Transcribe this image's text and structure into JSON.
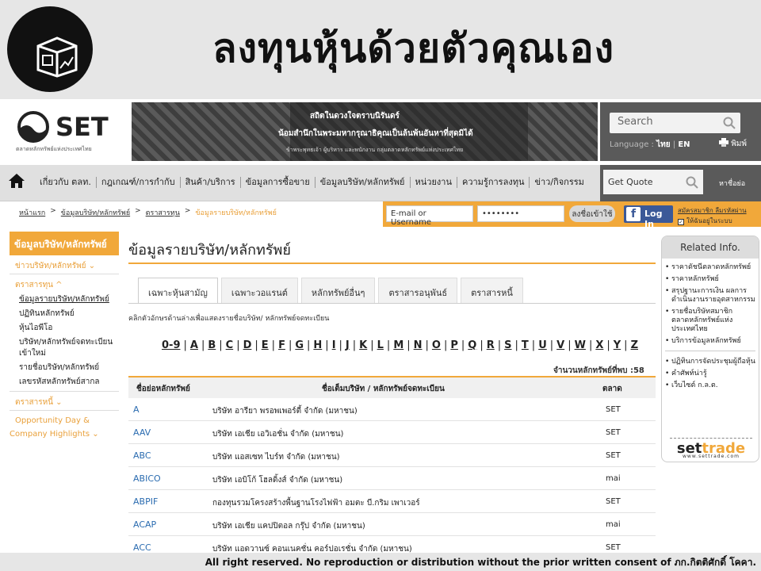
{
  "slide": {
    "title": "ลงทุนหุ้นด้วยตัวคุณเอง"
  },
  "header": {
    "logo_text": "SET",
    "logo_sub": "ตลาดหลักทรัพย์แห่งประเทศไทย",
    "banner_line1": "สถิตในดวงใจตราบนิรันดร์",
    "banner_line2": "น้อมสำนึกในพระมหากรุณาธิคุณเป็นล้นพ้นอันหาที่สุดมิได้",
    "banner_line3": "ข้าพระพุทธเจ้า ผู้บริหาร และพนักงาน กลุ่มตลาดหลักทรัพย์แห่งประเทศไทย",
    "search_placeholder": "Search",
    "language_label": "Language :",
    "lang_th": "ไทย",
    "lang_en": "EN",
    "print_label": "พิมพ์"
  },
  "nav": {
    "items": [
      "เกี่ยวกับ ตลท.",
      "กฎเกณฑ์/การกำกับ",
      "สินค้า/บริการ",
      "ข้อมูลการซื้อขาย",
      "ข้อมูลบริษัท/หลักทรัพย์",
      "หน่วยงาน",
      "ความรู้การลงทุน",
      "ข่าว/กิจกรรม"
    ],
    "quote_placeholder": "Get Quote",
    "find_label": "หาชื่อย่อ"
  },
  "breadcrumb": {
    "items": [
      "หน้าแรก",
      "ข้อมูลบริษัท/หลักทรัพย์",
      "ตราสารทุน"
    ],
    "current": "ข้อมูลรายบริษัท/หลักทรัพย์",
    "sep": ">"
  },
  "login": {
    "email_placeholder": "E-mail or Username",
    "password_value": "••••••••",
    "login_button": "ลงชื่อเข้าใช้",
    "fb_label": "Log In",
    "register": "สมัครสมาชิก",
    "forgot": "ลืมรหัสผ่าน",
    "remember": "ให้ฉันอยู่ในระบบ"
  },
  "sidebar": {
    "header": "ข้อมูลบริษัท/หลักทรัพย์",
    "section_news": "ข่าวบริษัท/หลักทรัพย์ ⌄",
    "section_equity": "ตราสารทุน ^",
    "items": [
      "ข้อมูลรายบริษัท/หลักทรัพย์",
      "ปฏิทินหลักทรัพย์",
      "หุ้นไอพีโอ",
      "บริษัท/หลักทรัพย์จดทะเบียนเข้าใหม่",
      "รายชื่อบริษัท/หลักทรัพย์",
      "เลขรหัสหลักทรัพย์สากล"
    ],
    "section_debt": "ตราสารหนี้ ⌄",
    "opportunity_1": "Opportunity Day &",
    "opportunity_2": "Company Highlights ⌄"
  },
  "main": {
    "title": "ข้อมูลรายบริษัท/หลักทรัพย์",
    "tabs": [
      "เฉพาะหุ้นสามัญ",
      "เฉพาะวอแรนต์",
      "หลักทรัพย์อื่นๆ",
      "ตราสารอนุพันธ์",
      "ตราสารหนี้"
    ],
    "hint": "คลิกตัวอักษรด้านล่างเพื่อแสดงรายชื่อบริษัท/ หลักทรัพย์จดทะเบียน",
    "letters": [
      "0-9",
      "A",
      "B",
      "C",
      "D",
      "E",
      "F",
      "G",
      "H",
      "I",
      "J",
      "K",
      "L",
      "M",
      "N",
      "O",
      "P",
      "Q",
      "R",
      "S",
      "T",
      "U",
      "V",
      "W",
      "X",
      "Y",
      "Z"
    ],
    "count_label": "จำนวนหลักทรัพย์ที่พบ :58",
    "columns": [
      "ชื่อย่อหลักทรัพย์",
      "ชื่อเต็มบริษัท / หลักทรัพย์จดทะเบียน",
      "ตลาด"
    ],
    "rows": [
      {
        "symbol": "A",
        "name": "บริษัท อารียา พรอพเพอร์ตี้ จำกัด (มหาชน)",
        "market": "SET"
      },
      {
        "symbol": "AAV",
        "name": "บริษัท เอเชีย เอวิเอชั่น จำกัด (มหาชน)",
        "market": "SET"
      },
      {
        "symbol": "ABC",
        "name": "บริษัท แอสเซท ไบร์ท จำกัด (มหาชน)",
        "market": "SET"
      },
      {
        "symbol": "ABICO",
        "name": "บริษัท เอบิโก้ โฮลดิ้งส์ จำกัด (มหาชน)",
        "market": "mai"
      },
      {
        "symbol": "ABPIF",
        "name": "กองทุนรวมโครงสร้างพื้นฐานโรงไฟฟ้า อมตะ บี.กริม เพาเวอร์",
        "market": "SET"
      },
      {
        "symbol": "ACAP",
        "name": "บริษัท เอเชีย แคปปิตอล กรุ๊ป จำกัด (มหาชน)",
        "market": "mai"
      },
      {
        "symbol": "ACC",
        "name": "บริษัท แอดวานซ์ คอนเนคชั่น คอร์ปอเรชั่น จำกัด (มหาชน)",
        "market": "SET"
      }
    ]
  },
  "related": {
    "title": "Related Info.",
    "items_a": [
      "ราคาดัชนีตลาดหลักทรัพย์",
      "ราคาหลักทรัพย์",
      "สรุปฐานะการเงิน ผลการดำเนินงานรายอุตสาหกรรม",
      "รายชื่อบริษัทสมาชิกตลาดหลักทรัพย์แห่งประเทศไทย",
      "บริการข้อมูลหลักทรัพย์"
    ],
    "items_b": [
      "ปฏิทินการจัดประชุมผู้ถือหุ้น",
      "คำศัพท์น่ารู้",
      "เว็บไซต์ ก.ล.ต."
    ],
    "brand_a": "set",
    "brand_b": "trade",
    "brand_url": "www.settrade.com"
  },
  "footer": {
    "text": "All right reserved. No reproduction or distribution without the prior written consent of ภก.กิตติศักดิ์ โคคา."
  },
  "colors": {
    "accent": "#f1a83a",
    "link": "#2b6cb0",
    "nav_dark": "#5a5a5a",
    "facebook": "#3b5998"
  }
}
